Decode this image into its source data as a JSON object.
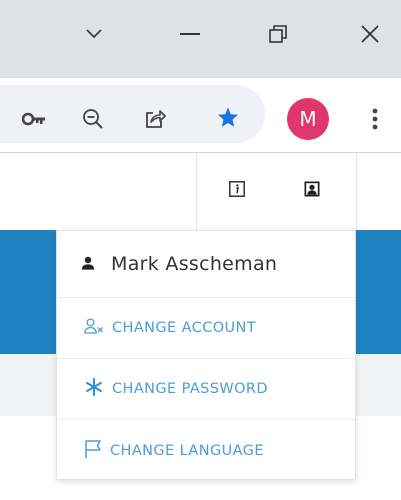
{
  "window_controls": {
    "tab_search_icon": "chevron-down-icon",
    "minimize_icon": "minimize-icon",
    "restore_icon": "restore-icon",
    "close_icon": "close-icon"
  },
  "toolbar": {
    "icons": [
      "key-icon",
      "zoom-out-icon",
      "share-icon",
      "bookmark-star-icon",
      "more-vert-icon"
    ],
    "bookmark_color": "#1a73e8",
    "avatar": {
      "letter": "M",
      "color": "#e0366d"
    }
  },
  "app_header": {
    "info_icon": "info-icon",
    "user_icon": "user-portrait-icon",
    "band_color": "#1f83c2"
  },
  "user_menu": {
    "user_name": "Mark Asscheman",
    "items": [
      {
        "label": "CHANGE ACCOUNT",
        "icon": "user-switch-icon"
      },
      {
        "label": "CHANGE PASSWORD",
        "icon": "asterisk-icon"
      },
      {
        "label": "CHANGE LANGUAGE",
        "icon": "flag-icon"
      }
    ],
    "link_color": "#4a9edb"
  }
}
